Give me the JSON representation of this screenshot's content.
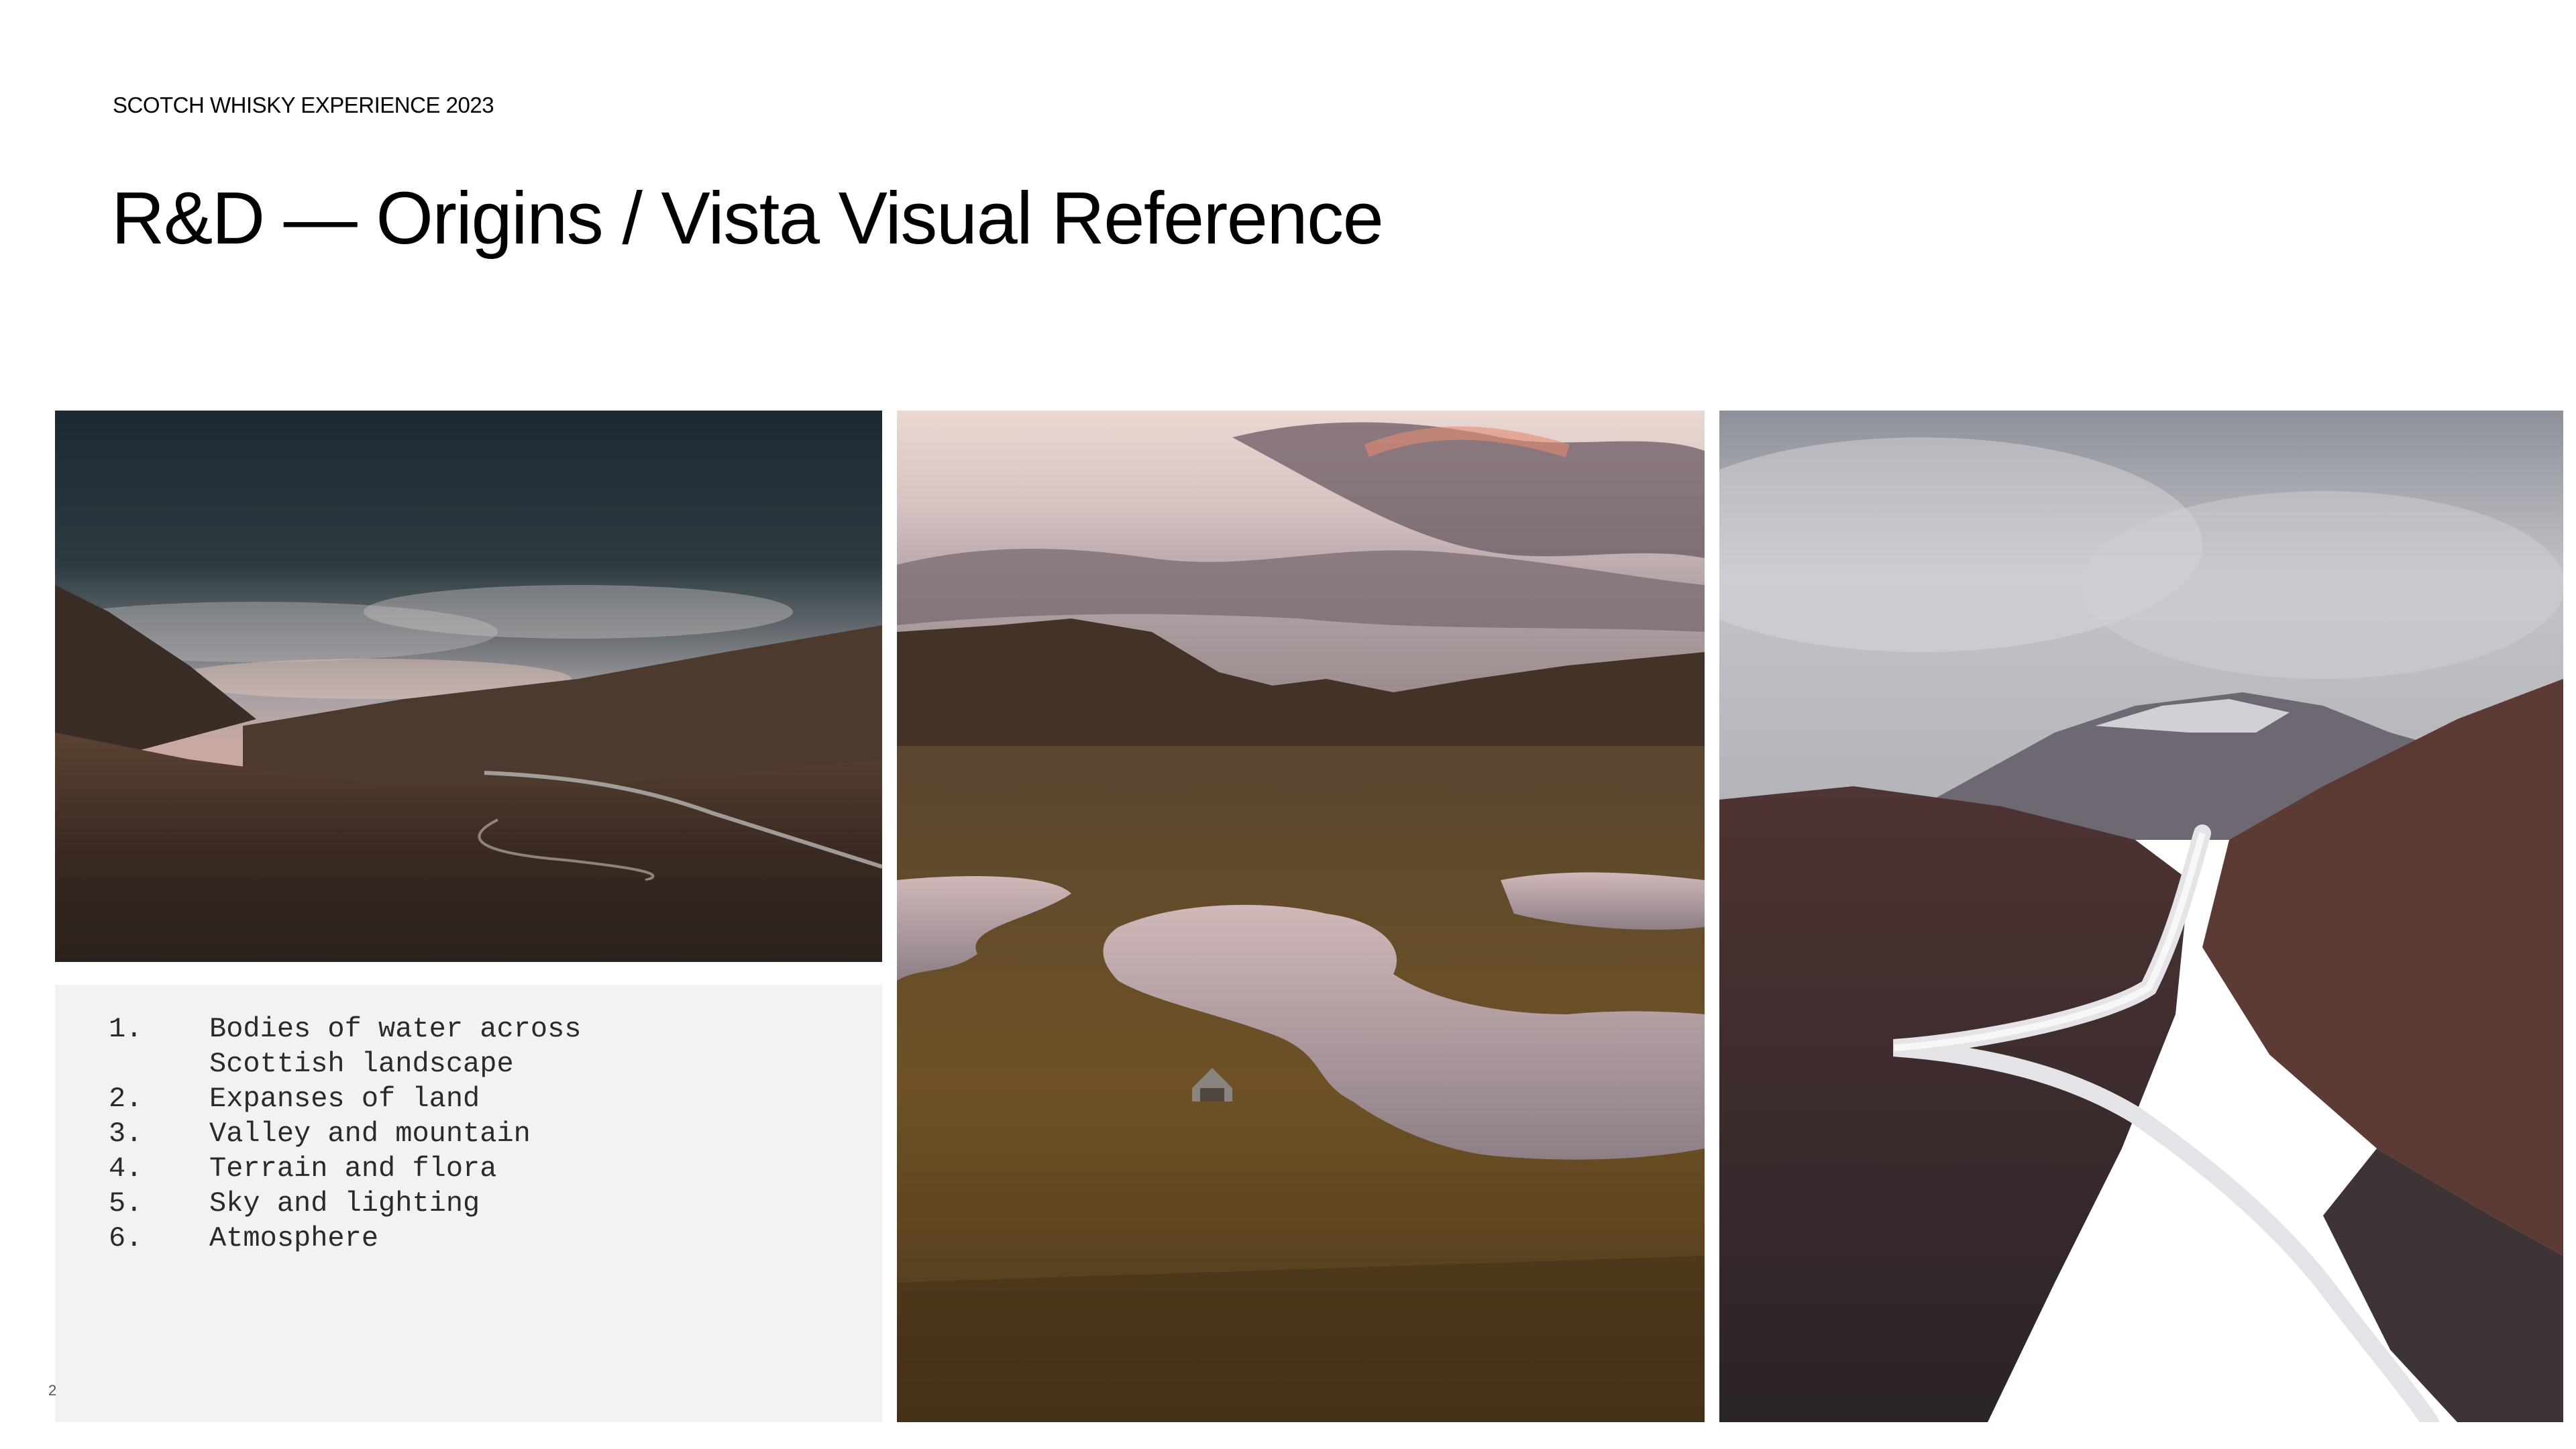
{
  "header": {
    "eyebrow": "SCOTCH WHISKY EXPERIENCE 2023",
    "title": "R&D — Origins / Vista Visual Reference"
  },
  "list": {
    "items": [
      {
        "num": "1.",
        "text": "Bodies of water across Scottish landscape"
      },
      {
        "num": "2.",
        "text": "Expanses of land"
      },
      {
        "num": "3.",
        "text": "Valley and mountain"
      },
      {
        "num": "4.",
        "text": "Terrain and flora"
      },
      {
        "num": "5.",
        "text": "Sky and lighting"
      },
      {
        "num": "6.",
        "text": "Atmosphere"
      }
    ]
  },
  "footer": {
    "page_number": "2"
  },
  "colors": {
    "panel_bg": "#f2f2f2",
    "text": "#000000"
  }
}
